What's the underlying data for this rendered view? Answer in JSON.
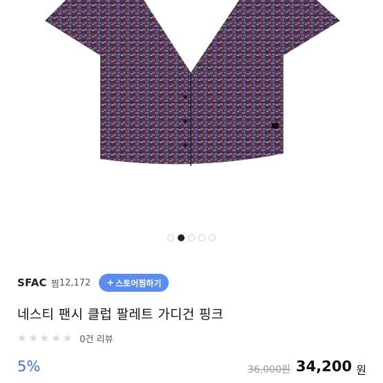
{
  "product": {
    "image_description_icon": "cardigan-product-photo",
    "brand": "SFAC",
    "wish_label": "찜",
    "wish_count": "12,172",
    "store_wish_button": "스토어찜하기",
    "title": "네스티 팬시 클럽 팔레트 가디건 핑크",
    "rating_stars": 0,
    "rating_max": 5,
    "review_count_text": "0건 리뷰",
    "discount": "5%",
    "original_price": "36,000원",
    "sale_price": "34,200",
    "currency": "원"
  },
  "carousel": {
    "total": 5,
    "active_index": 1
  },
  "colors": {
    "accent": "#5b8def",
    "discount": "#3f6fe0"
  }
}
